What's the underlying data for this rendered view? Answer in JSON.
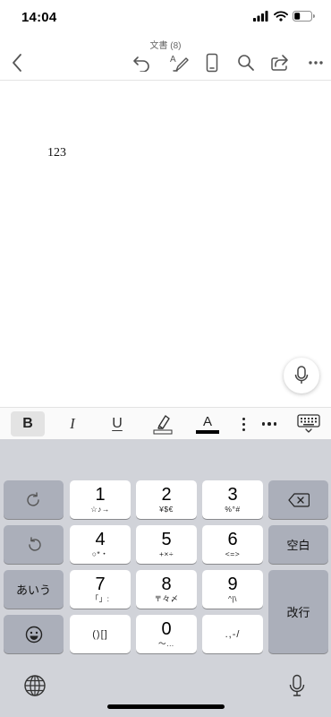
{
  "status_bar": {
    "time": "14:04",
    "icons": [
      "cellular-signal-icon",
      "wifi-icon",
      "battery-icon"
    ]
  },
  "toolbar": {
    "document_title": "文書 (8)",
    "buttons": [
      "back-chevron-icon",
      "undo-icon",
      "text-edit-pen-icon",
      "mobile-view-icon",
      "search-icon",
      "share-icon",
      "more-icon"
    ]
  },
  "document": {
    "text": "123"
  },
  "format_bar": {
    "bold_label": "B",
    "italic_label": "I",
    "underline_label": "U",
    "font_color_label": "A",
    "font_color": "#000000"
  },
  "keyboard": {
    "left_column": {
      "redo_icon": "redo-arrow-icon",
      "undo_icon": "undo-arrow-icon",
      "kana_label": "あいう",
      "emoji_icon": "emoji-icon"
    },
    "keys": [
      {
        "num": "1",
        "sub": "☆♪→"
      },
      {
        "num": "2",
        "sub": "¥$€"
      },
      {
        "num": "3",
        "sub": "%°#"
      },
      {
        "num": "4",
        "sub": "○*・"
      },
      {
        "num": "5",
        "sub": "+×÷"
      },
      {
        "num": "6",
        "sub": "<=>"
      },
      {
        "num": "7",
        "sub": "「」:"
      },
      {
        "num": "8",
        "sub": "〒々〆"
      },
      {
        "num": "9",
        "sub": "^|\\"
      },
      {
        "num": "0",
        "sub": "〜…"
      }
    ],
    "brackets_key": "()[]",
    "punct_key": ".,-/",
    "space_label": "空白",
    "return_label": "改行",
    "colors": {
      "background": "#d1d3d9",
      "key_light": "#ffffff",
      "key_dark": "#abafba"
    }
  }
}
